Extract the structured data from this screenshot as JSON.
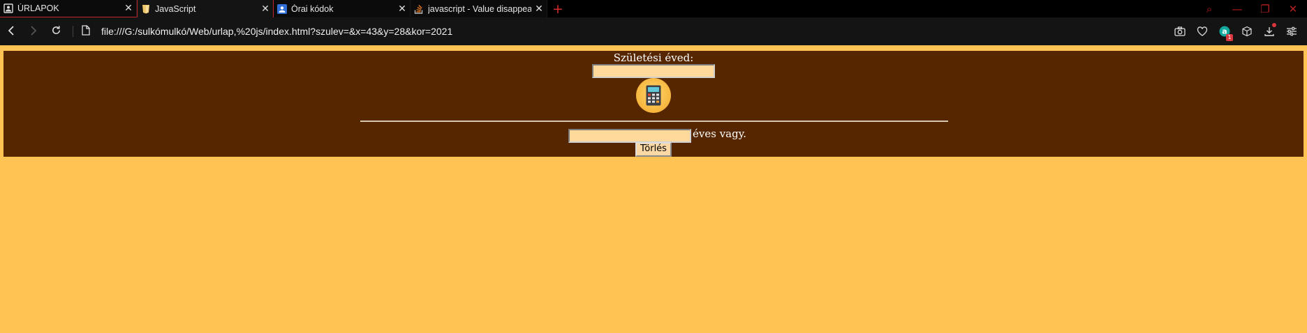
{
  "browser": {
    "tabs": [
      {
        "title": "ÚRLAPOK",
        "close": "✕"
      },
      {
        "title": "JavaScript",
        "close": "✕"
      },
      {
        "title": "Órai kódok",
        "close": "✕"
      },
      {
        "title": "javascript - Value disappear",
        "close": "✕"
      }
    ],
    "new_tab": "+",
    "window_controls": {
      "search": "⌕",
      "minimize": "—",
      "restore": "❐",
      "close": "✕"
    },
    "url": "file:///G:/sulkómulkó/Web/urlap,%20js/index.html?szulev=&x=43&y=28&kor=2021",
    "extension_badge": "1"
  },
  "form": {
    "label": "Születési éved:",
    "birth_year_value": "",
    "age_value": "",
    "suffix": "éves vagy.",
    "clear_button": "Törlés"
  },
  "colors": {
    "page_background": "#ffc354",
    "form_background": "#562600",
    "input_background": "#ffd89c",
    "accent_red": "#c0272d"
  }
}
